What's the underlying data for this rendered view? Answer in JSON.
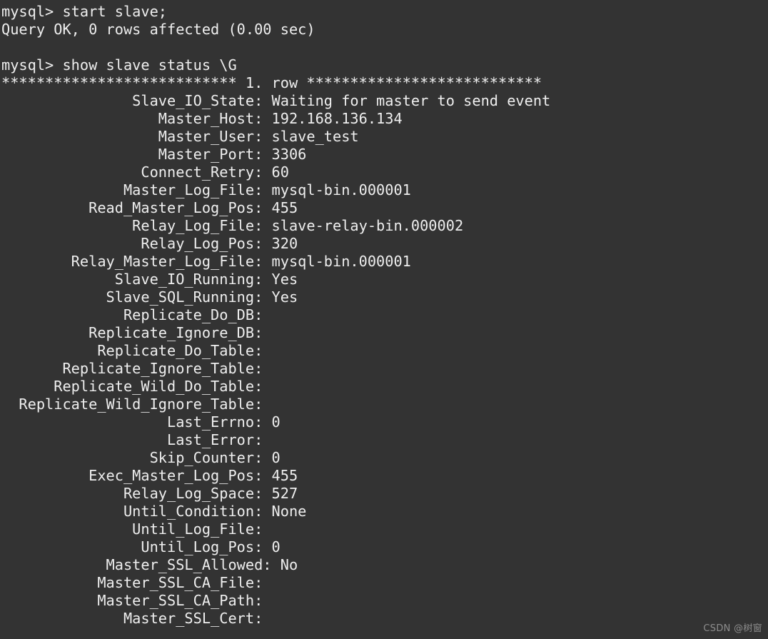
{
  "terminal": {
    "background_color": "#333333",
    "foreground_color": "#eeeeee",
    "prompt": "mysql>",
    "lines": [
      "mysql> start slave;",
      "Query OK, 0 rows affected (0.00 sec)",
      "",
      "mysql> show slave status \\G",
      "*************************** 1. row ***************************",
      "               Slave_IO_State: Waiting for master to send event",
      "                  Master_Host: 192.168.136.134",
      "                  Master_User: slave_test",
      "                  Master_Port: 3306",
      "                Connect_Retry: 60",
      "              Master_Log_File: mysql-bin.000001",
      "          Read_Master_Log_Pos: 455",
      "               Relay_Log_File: slave-relay-bin.000002",
      "                Relay_Log_Pos: 320",
      "        Relay_Master_Log_File: mysql-bin.000001",
      "             Slave_IO_Running: Yes",
      "            Slave_SQL_Running: Yes",
      "              Replicate_Do_DB:",
      "          Replicate_Ignore_DB:",
      "           Replicate_Do_Table:",
      "       Replicate_Ignore_Table:",
      "      Replicate_Wild_Do_Table:",
      "  Replicate_Wild_Ignore_Table:",
      "                   Last_Errno: 0",
      "                   Last_Error:",
      "                 Skip_Counter: 0",
      "          Exec_Master_Log_Pos: 455",
      "              Relay_Log_Space: 527",
      "              Until_Condition: None",
      "               Until_Log_File:",
      "                Until_Log_Pos: 0",
      "            Master_SSL_Allowed: No",
      "           Master_SSL_CA_File:",
      "           Master_SSL_CA_Path:",
      "              Master_SSL_Cert:"
    ],
    "commands": [
      "start slave;",
      "show slave status \\G"
    ],
    "query_result": "Query OK, 0 rows affected (0.00 sec)",
    "row_separator": "*************************** 1. row ***************************",
    "status_fields": [
      {
        "name": "Slave_IO_State",
        "value": "Waiting for master to send event"
      },
      {
        "name": "Master_Host",
        "value": "192.168.136.134"
      },
      {
        "name": "Master_User",
        "value": "slave_test"
      },
      {
        "name": "Master_Port",
        "value": "3306"
      },
      {
        "name": "Connect_Retry",
        "value": "60"
      },
      {
        "name": "Master_Log_File",
        "value": "mysql-bin.000001"
      },
      {
        "name": "Read_Master_Log_Pos",
        "value": "455"
      },
      {
        "name": "Relay_Log_File",
        "value": "slave-relay-bin.000002"
      },
      {
        "name": "Relay_Log_Pos",
        "value": "320"
      },
      {
        "name": "Relay_Master_Log_File",
        "value": "mysql-bin.000001"
      },
      {
        "name": "Slave_IO_Running",
        "value": "Yes"
      },
      {
        "name": "Slave_SQL_Running",
        "value": "Yes"
      },
      {
        "name": "Replicate_Do_DB",
        "value": ""
      },
      {
        "name": "Replicate_Ignore_DB",
        "value": ""
      },
      {
        "name": "Replicate_Do_Table",
        "value": ""
      },
      {
        "name": "Replicate_Ignore_Table",
        "value": ""
      },
      {
        "name": "Replicate_Wild_Do_Table",
        "value": ""
      },
      {
        "name": "Replicate_Wild_Ignore_Table",
        "value": ""
      },
      {
        "name": "Last_Errno",
        "value": "0"
      },
      {
        "name": "Last_Error",
        "value": ""
      },
      {
        "name": "Skip_Counter",
        "value": "0"
      },
      {
        "name": "Exec_Master_Log_Pos",
        "value": "455"
      },
      {
        "name": "Relay_Log_Space",
        "value": "527"
      },
      {
        "name": "Until_Condition",
        "value": "None"
      },
      {
        "name": "Until_Log_File",
        "value": ""
      },
      {
        "name": "Until_Log_Pos",
        "value": "0"
      },
      {
        "name": "Master_SSL_Allowed",
        "value": "No"
      },
      {
        "name": "Master_SSL_CA_File",
        "value": ""
      },
      {
        "name": "Master_SSL_CA_Path",
        "value": ""
      },
      {
        "name": "Master_SSL_Cert",
        "value": ""
      }
    ]
  },
  "watermark": {
    "text": "CSDN @树窗",
    "color": "#8d8d8d"
  }
}
